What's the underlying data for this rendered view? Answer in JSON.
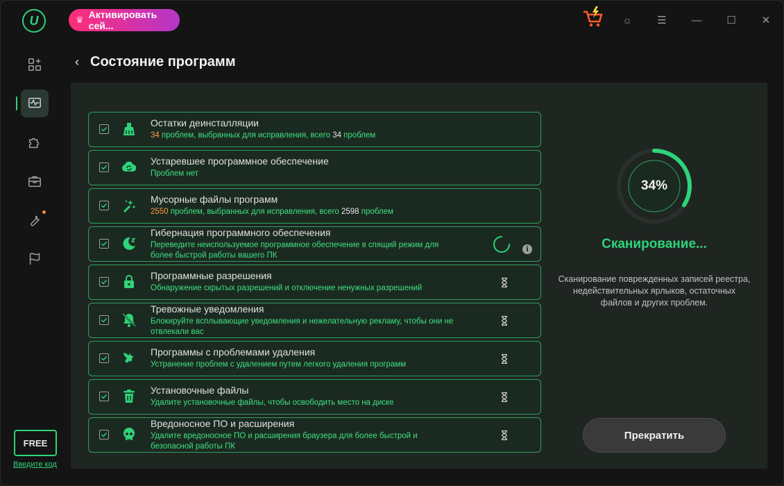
{
  "app": {
    "logo_letter": "U",
    "activate_label": "Активировать сей...",
    "page_title": "Состояние программ",
    "free_badge": "FREE",
    "enter_code": "Введите код"
  },
  "items": [
    {
      "title": "Остатки деинсталляции",
      "desc_parts": {
        "n1": "34",
        "t1": " проблем, выбранных для исправления, всего ",
        "n2": "34",
        "t2": " проблем"
      },
      "status": "none"
    },
    {
      "title": "Устаревшее программное обеспечение",
      "desc": "Проблем нет",
      "status": "none"
    },
    {
      "title": "Мусорные файлы программ",
      "desc_parts": {
        "n1": "2550",
        "t1": " проблем, выбранных для исправления, всего ",
        "n2": "2598",
        "t2": " проблем"
      },
      "status": "none"
    },
    {
      "title": "Гибернация программного обеспечения",
      "desc": "Переведите неиспользуемое программное обеспечение в спящий режим для более быстрой работы вашего ПК",
      "status": "loading"
    },
    {
      "title": "Программные разрешения",
      "desc": "Обнаружение скрытых разрешений и отключение ненужных разрешений",
      "status": "waiting"
    },
    {
      "title": "Тревожные уведомления",
      "desc": "Блокируйте всплывающие уведомления и нежелательную рекламу, чтобы они не отвлекали вас",
      "status": "waiting"
    },
    {
      "title": "Программы с проблемами удаления",
      "desc": "Устранение проблем с удалением путем легкого удаления программ",
      "status": "waiting"
    },
    {
      "title": "Установочные файлы",
      "desc": "Удалите установочные файлы, чтобы освободить место на диске",
      "status": "waiting"
    },
    {
      "title": "Вредоносное ПО и расширения",
      "desc": "Удалите вредоносное ПО и расширения браузера для более быстрой и безопасной работы ПК",
      "status": "waiting"
    }
  ],
  "progress": {
    "percent_label": "34%",
    "fraction": 0.34,
    "title": "Сканирование...",
    "description": "Сканирование поврежденных записей реестра, недействительных ярлыков, остаточных файлов и других проблем.",
    "stop_label": "Прекратить"
  },
  "colors": {
    "accent": "#2ed47a",
    "highlight_number": "#ff9a3c",
    "panel_bg": "#1f2521"
  }
}
